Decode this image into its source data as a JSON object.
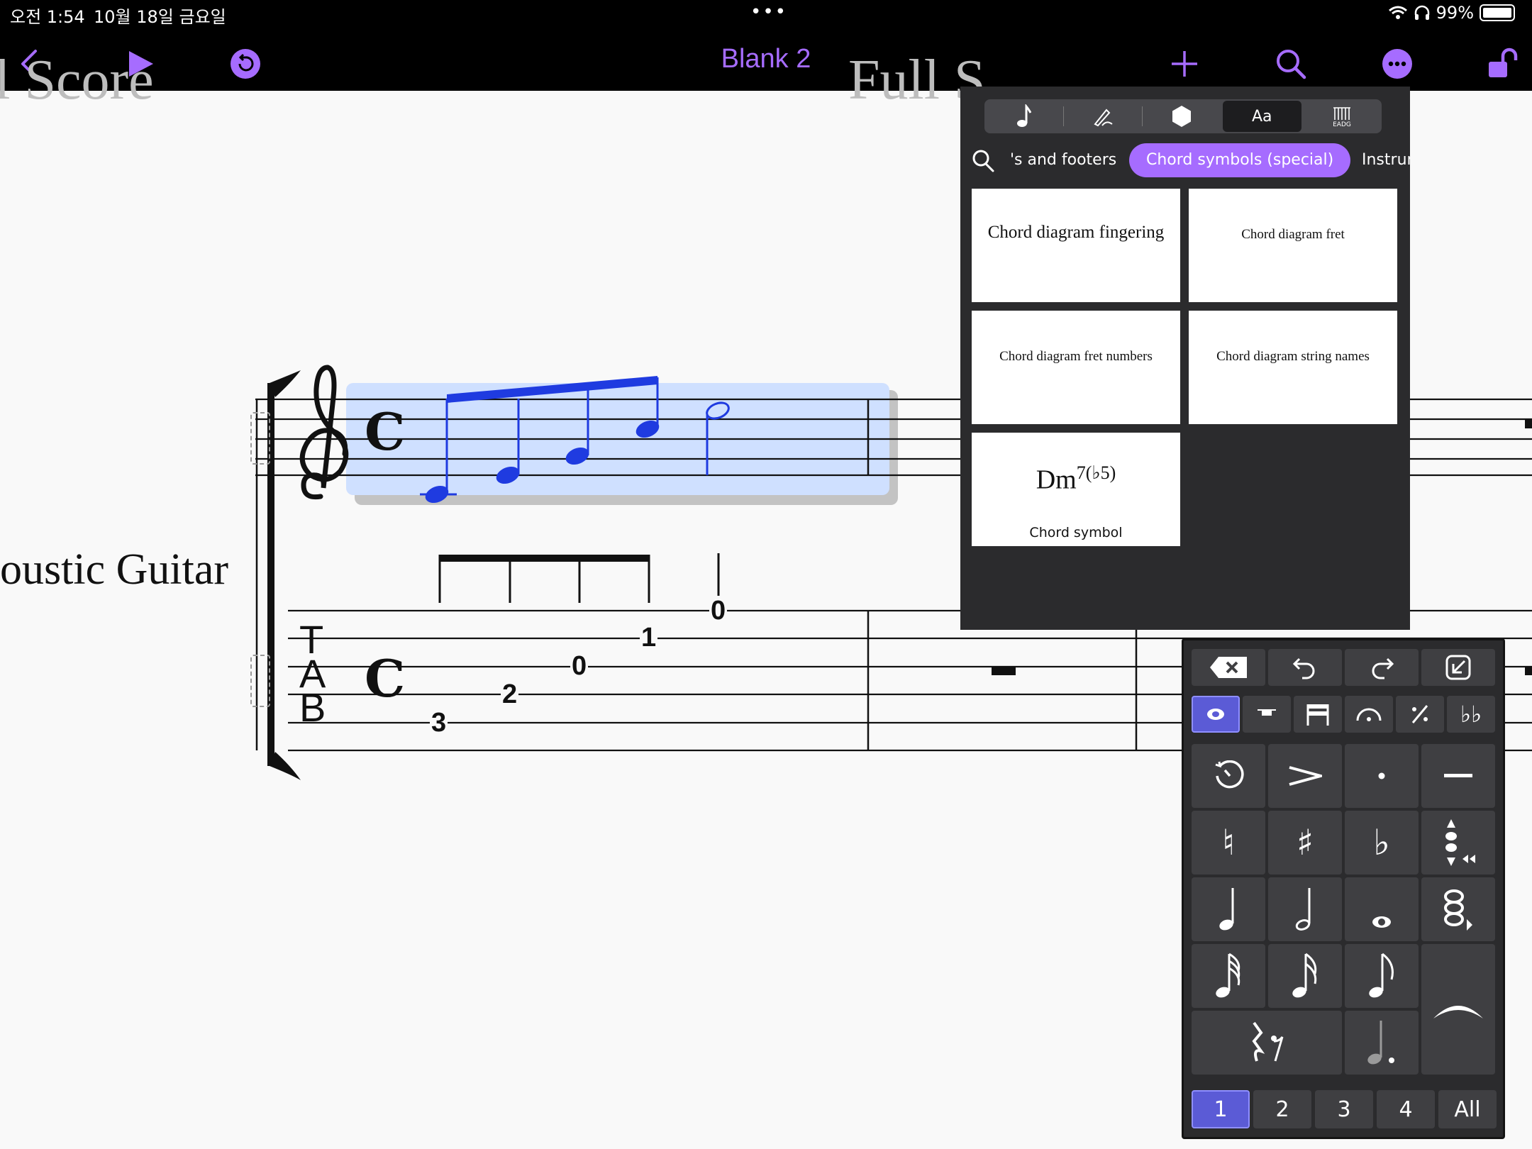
{
  "status": {
    "time": "오전 1:54",
    "date": "10월 18일 금요일",
    "more": "•••",
    "battery": "99%"
  },
  "toolbar": {
    "title": "Blank 2",
    "icons": [
      "back-icon",
      "play-icon",
      "undo-circle-icon",
      "add-icon",
      "search-icon",
      "more-icon",
      "unlock-icon"
    ]
  },
  "colors": {
    "accent": "#a66cff",
    "selection": "#cfe0ff",
    "notes": "#1f3be0",
    "keypad_selected": "#5b5bd6"
  },
  "score": {
    "title_left": "ll Score",
    "title_right": "Full S",
    "instrument": "oustic Guitar",
    "time_signature": "C",
    "tab_clef": [
      "T",
      "A",
      "B"
    ],
    "tab_numbers": [
      "3",
      "2",
      "0",
      "1",
      "0"
    ]
  },
  "properties": {
    "tabs": [
      {
        "icon": "note-icon",
        "label": ""
      },
      {
        "icon": "pen-icon",
        "label": ""
      },
      {
        "icon": "hexagon-icon",
        "label": ""
      },
      {
        "icon": "",
        "label": "Aa"
      },
      {
        "icon": "string-names-icon",
        "label": ""
      }
    ],
    "categories": [
      "'s and footers",
      "Chord symbols (special)",
      "Instrur"
    ],
    "selected_category": "Chord symbols (special)",
    "tiles": [
      {
        "label": "Chord diagram fingering"
      },
      {
        "label": "Chord diagram fret"
      },
      {
        "label": "Chord diagram fret numbers"
      },
      {
        "label": "Chord diagram string names"
      },
      {
        "label": "Chord symbol",
        "preview": "Dm",
        "preview_sup": "7(♭5)"
      }
    ]
  },
  "keypad": {
    "layouts": [
      "1",
      "2",
      "3",
      "4",
      "All"
    ],
    "selected_layout": "1"
  }
}
